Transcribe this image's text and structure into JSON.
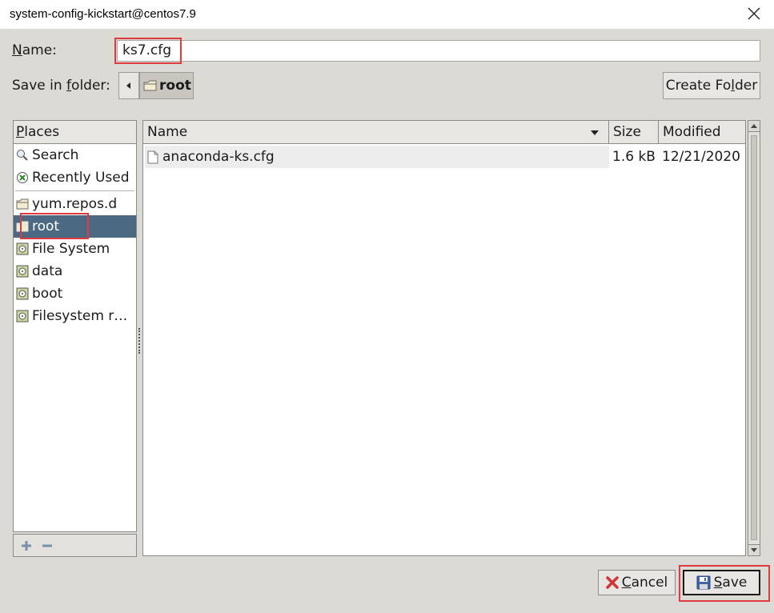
{
  "window": {
    "title": "system-config-kickstart@centos7.9"
  },
  "name_row": {
    "label_u": "N",
    "label_rest": "ame:",
    "value": "ks7.cfg"
  },
  "folder_row": {
    "label_a": "Save in ",
    "label_u": "f",
    "label_b": "older:",
    "current": "root",
    "create_u": "Create Fo",
    "create_ul": "l",
    "create_rest": "der"
  },
  "places": {
    "header_u": "P",
    "header_rest": "laces",
    "items": [
      {
        "label": "Search",
        "icon": "search-icon"
      },
      {
        "label": "Recently Used",
        "icon": "recent-icon"
      },
      {
        "label": "yum.repos.d",
        "icon": "folder-icon"
      },
      {
        "label": "root",
        "icon": "folder-icon",
        "selected": true
      },
      {
        "label": "File System",
        "icon": "drive-icon"
      },
      {
        "label": "data",
        "icon": "drive-icon"
      },
      {
        "label": "boot",
        "icon": "drive-icon"
      },
      {
        "label": "Filesystem r…",
        "icon": "drive-icon"
      }
    ]
  },
  "files": {
    "columns": {
      "name": "Name",
      "size": "Size",
      "modified": "Modified"
    },
    "rows": [
      {
        "name": "anaconda-ks.cfg",
        "size": "1.6 kB",
        "modified": "12/21/2020"
      }
    ]
  },
  "buttons": {
    "cancel_u": "C",
    "cancel_rest": "ancel",
    "save_u": "S",
    "save_rest": "ave"
  },
  "colors": {
    "selection": "#4b6983",
    "highlight": "#e0393e",
    "dialog_bg": "#dcdad5"
  }
}
